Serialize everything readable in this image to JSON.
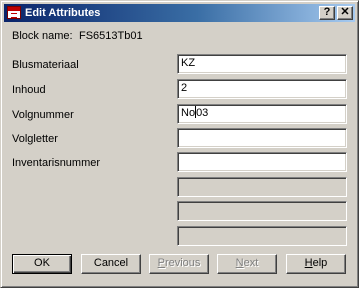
{
  "window": {
    "title": "Edit Attributes",
    "icon": "autocad-app-icon"
  },
  "block": {
    "label": "Block name:",
    "value": "FS6513Tb01"
  },
  "attributes": [
    {
      "label": "Blusmateriaal",
      "value": "KZ"
    },
    {
      "label": "Inhoud",
      "value": "2"
    },
    {
      "label": "Volgnummer",
      "value": "No03",
      "value_before_caret": "No",
      "value_after_caret": "03"
    },
    {
      "label": "Volgletter",
      "value": ""
    },
    {
      "label": "Inventarisnummer",
      "value": ""
    },
    {
      "label": "",
      "value": "",
      "enabled": false
    },
    {
      "label": "",
      "value": "",
      "enabled": false
    },
    {
      "label": "",
      "value": "",
      "enabled": false
    }
  ],
  "buttons": {
    "ok": "OK",
    "cancel": "Cancel",
    "previous": {
      "mnemonic": "P",
      "rest": "revious",
      "enabled": false
    },
    "next": {
      "mnemonic": "N",
      "rest": "ext",
      "enabled": false
    },
    "help": {
      "mnemonic": "H",
      "rest": "elp"
    }
  }
}
